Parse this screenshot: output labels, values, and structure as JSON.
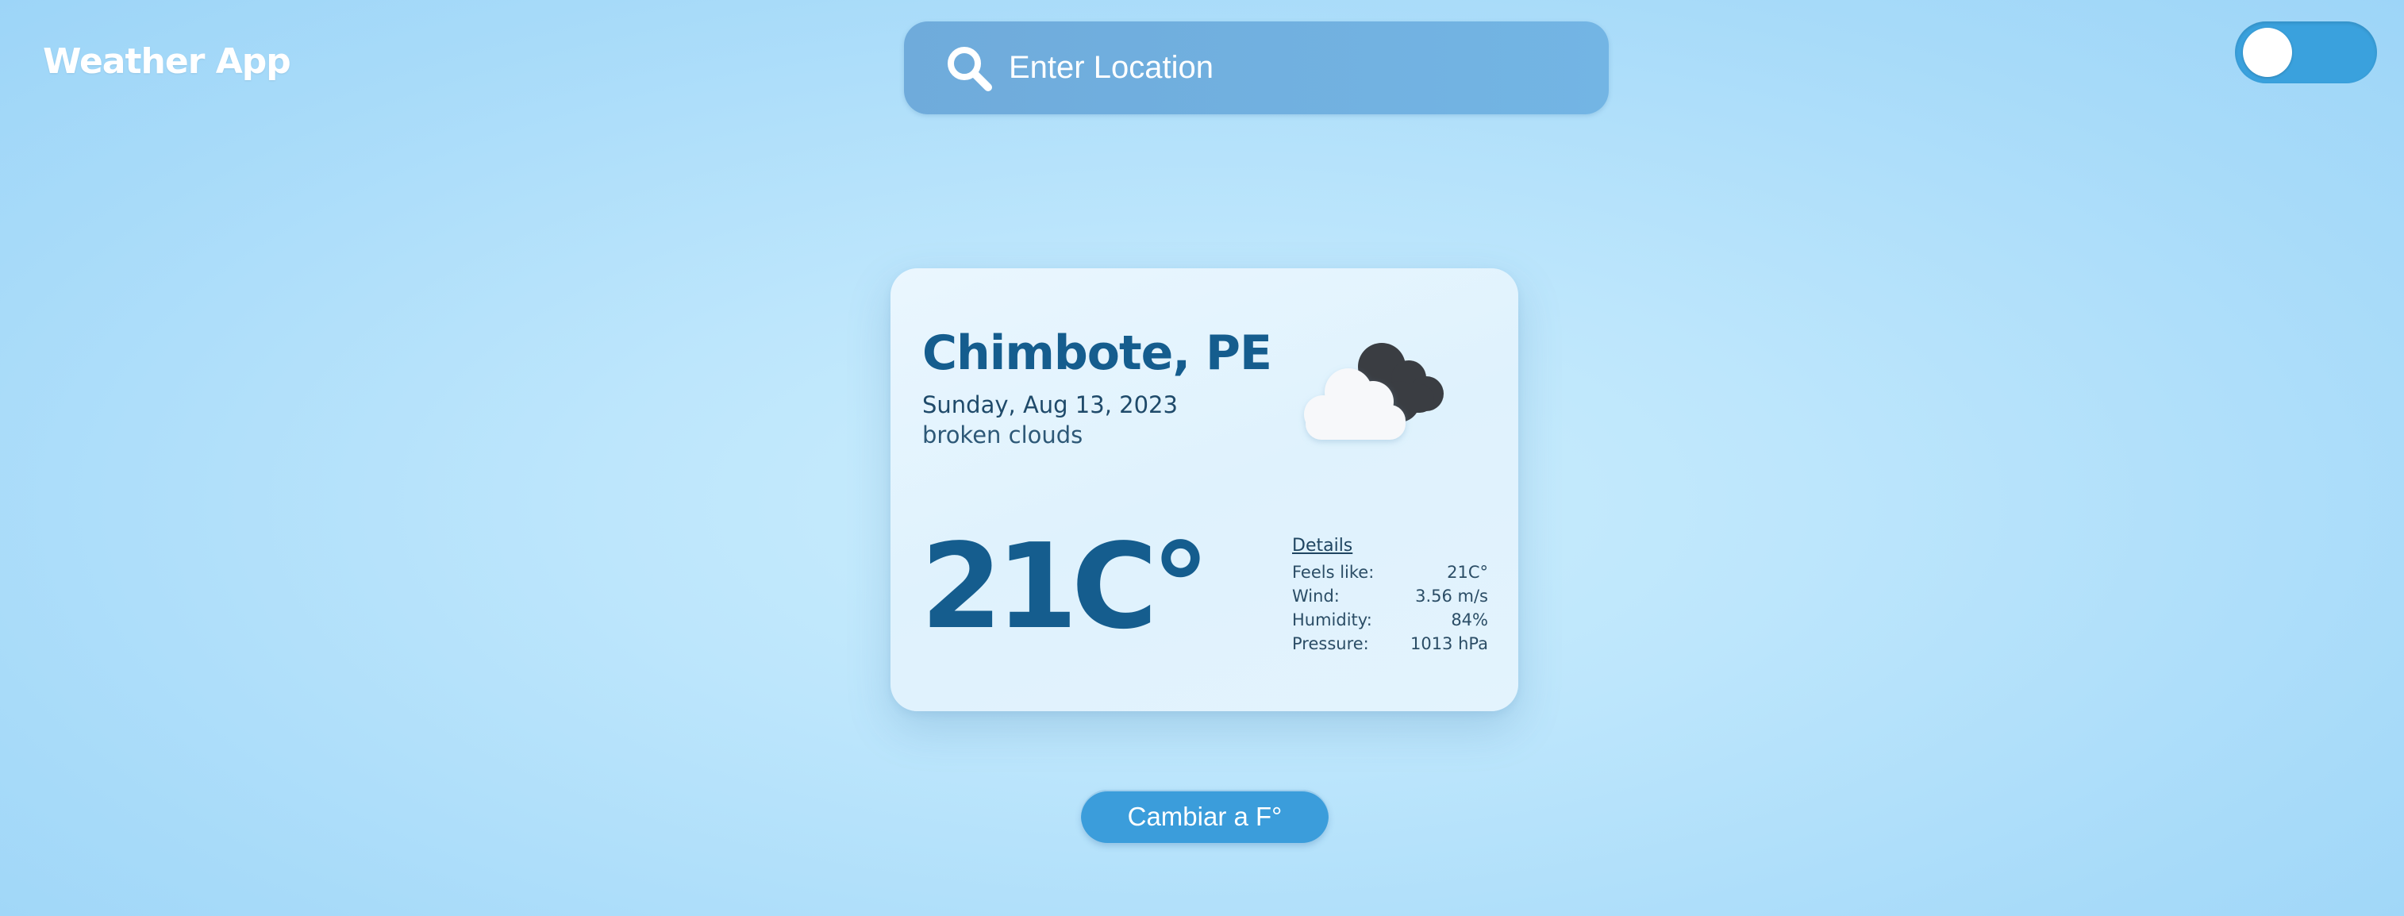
{
  "header": {
    "title": "Weather App",
    "search": {
      "placeholder": "Enter Location",
      "value": ""
    },
    "theme_toggle": {
      "state": "off"
    }
  },
  "card": {
    "city": "Chimbote, PE",
    "date": "Sunday, Aug 13, 2023",
    "condition": "broken clouds",
    "temperature": "21C°",
    "icon": "broken-clouds-icon",
    "details": {
      "heading": "Details",
      "rows": [
        {
          "label": "Feels like:",
          "value": "21C°"
        },
        {
          "label": "Wind:",
          "value": "3.56 m/s"
        },
        {
          "label": "Humidity:",
          "value": "84%"
        },
        {
          "label": "Pressure:",
          "value": "1013 hPa"
        }
      ]
    }
  },
  "footer": {
    "unit_button_label": "Cambiar a F°"
  },
  "colors": {
    "accent": "#3b9ddb",
    "title_text": "#155d8e",
    "search_bg": "#72b0df"
  }
}
